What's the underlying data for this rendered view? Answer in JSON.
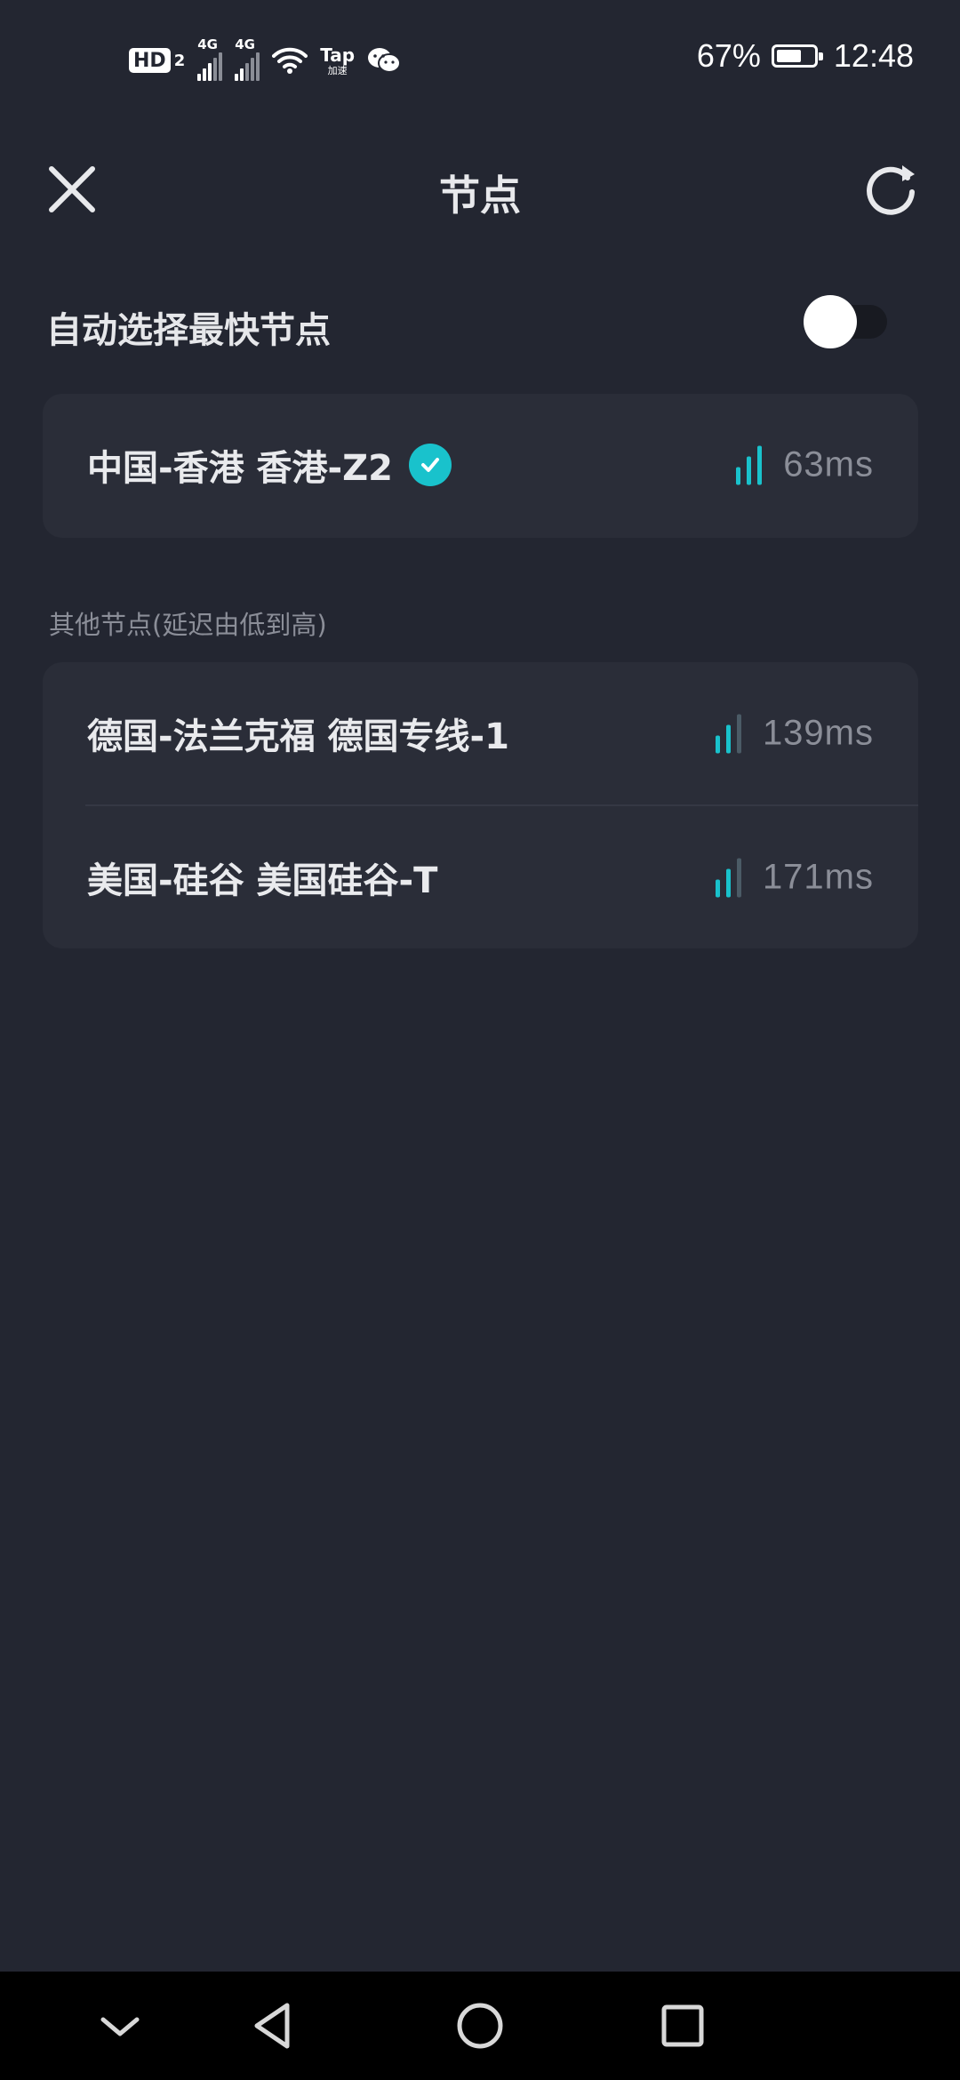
{
  "status_bar": {
    "hd": "HD",
    "hd_sub": "2",
    "sim1_label": "4G",
    "sim2_label": "4G",
    "tap_label": "Tap",
    "tap_sub": "加速",
    "battery_percent": "67%",
    "battery_level": 0.67,
    "time": "12:48"
  },
  "header": {
    "title": "节点"
  },
  "auto_select": {
    "label": "自动选择最快节点",
    "enabled": false
  },
  "current_node": {
    "name": "中国-香港 香港-Z2",
    "latency": "63ms",
    "selected": true
  },
  "others_section": {
    "label": "其他节点(延迟由低到高)",
    "nodes": [
      {
        "name": "德国-法兰克福 德国专线-1",
        "latency": "139ms"
      },
      {
        "name": "美国-硅谷 美国硅谷-T",
        "latency": "171ms"
      }
    ]
  },
  "colors": {
    "background": "#232631",
    "card": "#2a2d38",
    "accent": "#19c2cc",
    "muted_text": "#8b8e98"
  }
}
